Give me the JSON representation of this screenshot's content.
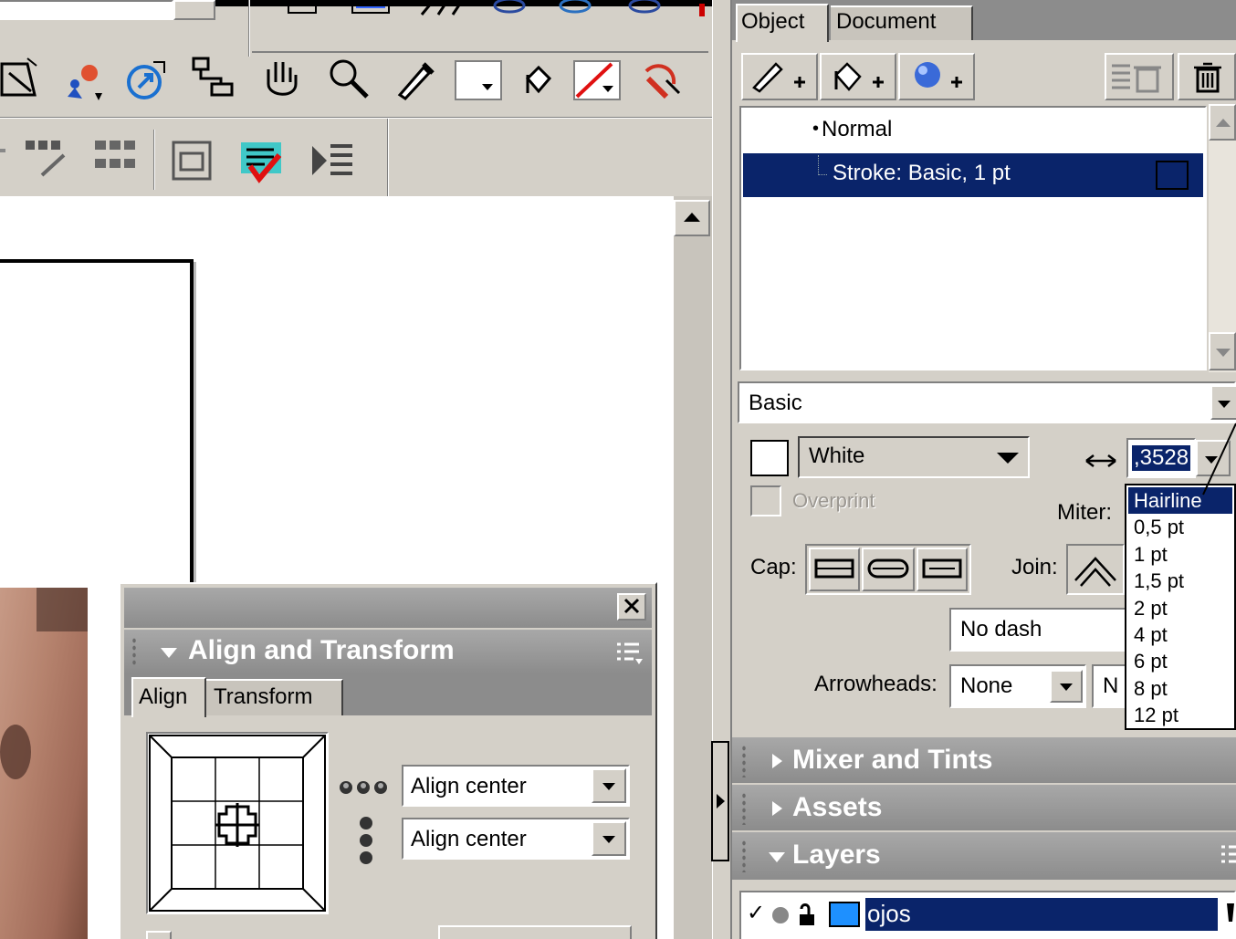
{
  "object_panel": {
    "tabs": [
      {
        "label": "Object"
      },
      {
        "label": "Document"
      }
    ],
    "tree": {
      "normal": "Normal",
      "stroke": "Stroke: Basic, 1 pt"
    },
    "stroke_category": "Basic",
    "stroke_color": "White",
    "stroke_width_value": ",3528",
    "overprint_label": "Overprint",
    "miter_label": "Miter:",
    "cap_label": "Cap:",
    "join_label": "Join:",
    "dash_value": "No dash",
    "arrowheads_label": "Arrowheads:",
    "arrowhead_start": "None",
    "arrowhead_end_partial": "N",
    "width_options": [
      "Hairline",
      "0,5 pt",
      "1 pt",
      "1,5 pt",
      "2 pt",
      "4 pt",
      "6 pt",
      "8 pt",
      "12 pt"
    ],
    "selected_width": "Hairline"
  },
  "panels": {
    "mixer": "Mixer and Tints",
    "assets": "Assets",
    "layers": "Layers"
  },
  "layers": [
    {
      "name": "ojos"
    }
  ],
  "align_panel": {
    "title": "Align and Transform",
    "tabs": [
      {
        "label": "Align"
      },
      {
        "label": "Transform"
      }
    ],
    "horizontal_align": "Align center",
    "vertical_align": "Align center"
  },
  "colors": {
    "selection": "#0a246a",
    "panel_bg": "#d4d0c8",
    "header_gray": "#9a9a9a",
    "layer_swatch": "#1e90ff"
  }
}
